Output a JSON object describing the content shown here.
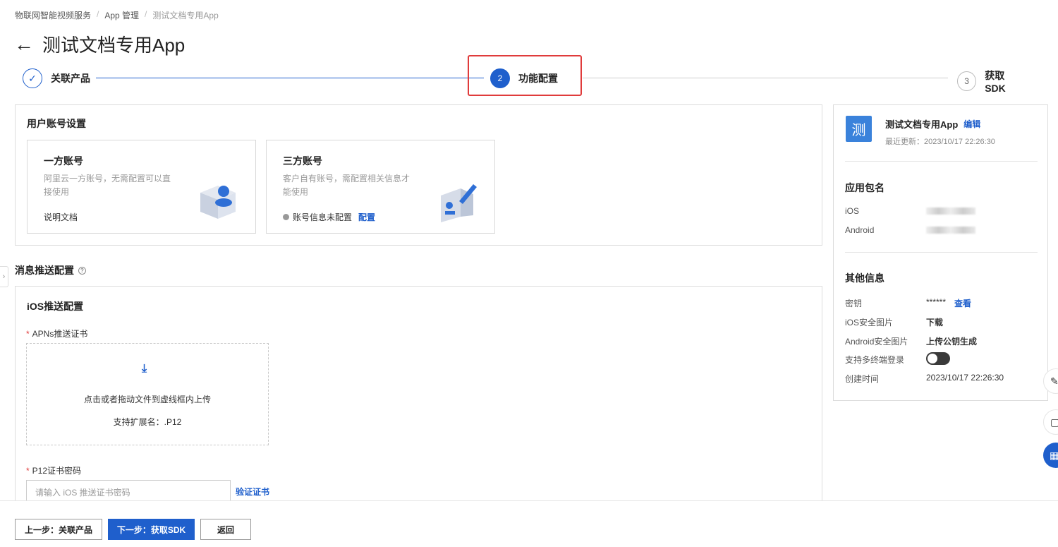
{
  "breadcrumb": [
    "物联网智能视频服务",
    "App 管理",
    "测试文档专用App"
  ],
  "page_title": "测试文档专用App",
  "steps": [
    {
      "index": "✓",
      "label": "关联产品",
      "status": "done"
    },
    {
      "index": "2",
      "label": "功能配置",
      "status": "active"
    },
    {
      "index": "3",
      "label": "获取SDK",
      "status": "pending"
    }
  ],
  "user_account": {
    "title": "用户账号设置",
    "first_party": {
      "name": "一方账号",
      "desc": "阿里云一方账号，无需配置可以直接使用",
      "link": "说明文档"
    },
    "third_party": {
      "name": "三方账号",
      "desc": "客户自有账号，需配置相关信息才能使用",
      "status": "账号信息未配置",
      "link": "配置"
    }
  },
  "push": {
    "title": "消息推送配置",
    "ios_title": "iOS推送配置",
    "apns_label": "APNs推送证书",
    "upload_hint": "点击或者拖动文件到虚线框内上传",
    "upload_ext": "支持扩展名：.P12",
    "p12_label": "P12证书密码",
    "p12_placeholder": "请输入 iOS 推送证书密码",
    "verify_link": "验证证书"
  },
  "info": {
    "avatar_char": "测",
    "app_name": "测试文档专用App",
    "edit": "编辑",
    "updated": "最近更新：2023/10/17 22:26:30",
    "package_title": "应用包名",
    "ios_label": "iOS",
    "android_label": "Android",
    "other_title": "其他信息",
    "secret_label": "密钥",
    "secret_value": "******",
    "secret_link": "查看",
    "ios_img_label": "iOS安全图片",
    "ios_img_link": "下载",
    "android_img_label": "Android安全图片",
    "android_img_link": "上传公钥生成",
    "multi_login_label": "支持多终端登录",
    "multi_login_enabled": false,
    "created_label": "创建时间",
    "created_value": "2023/10/17 22:26:30"
  },
  "footer": {
    "prev": "上一步：关联产品",
    "next": "下一步：获取SDK",
    "back": "返回"
  },
  "colors": {
    "accent": "#1f5fcc",
    "highlight": "#e03b3b",
    "avatar": "#3a82db"
  }
}
